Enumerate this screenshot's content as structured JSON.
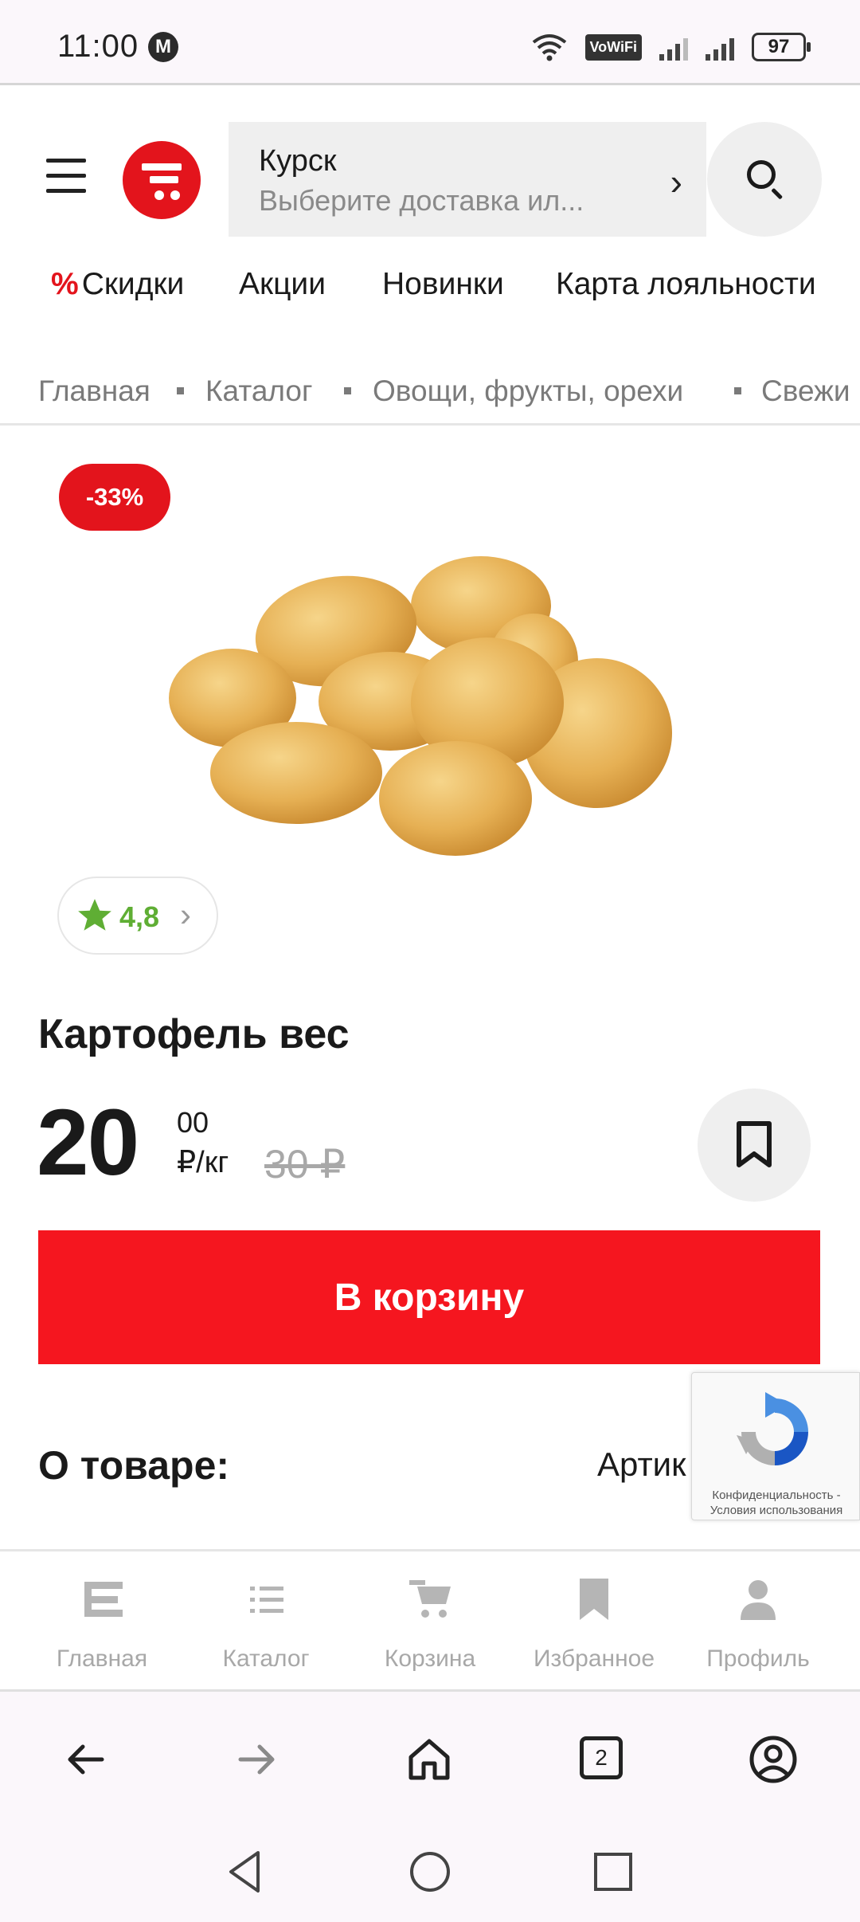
{
  "status_bar": {
    "time": "11:00",
    "vowifi": "VoWiFi",
    "battery": "97"
  },
  "header": {
    "location_city": "Курск",
    "location_subtitle": "Выберите доставка ил...",
    "nav": {
      "discounts": "Скидки",
      "promos": "Акции",
      "new": "Новинки",
      "loyalty": "Карта лояльности"
    }
  },
  "breadcrumb": [
    "Главная",
    "Каталог",
    "Овощи, фрукты, орехи",
    "Свежи"
  ],
  "product": {
    "discount_badge": "-33%",
    "rating": "4,8",
    "title": "Картофель вес",
    "price_int": "20",
    "price_cents": "00",
    "price_unit": "₽/кг",
    "old_price": "30 ₽",
    "cart_button": "В корзину",
    "about_heading": "О товаре:",
    "article_label": "Артик"
  },
  "recaptcha": {
    "line1": "Конфиденциальность -",
    "line2": "Условия использования"
  },
  "tabbar": {
    "home": "Главная",
    "catalog": "Каталог",
    "cart": "Корзина",
    "favorites": "Избранное",
    "profile": "Профиль"
  },
  "browser": {
    "tabs_count": "2"
  },
  "colors": {
    "brand_red": "#e3141c",
    "button_red": "#f5161f",
    "rating_green": "#5fae34"
  }
}
